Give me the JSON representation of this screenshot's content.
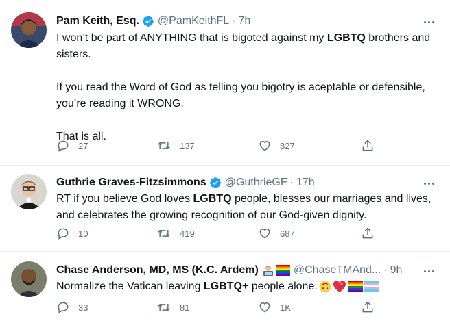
{
  "tweets": [
    {
      "name": "Pam Keith, Esq.",
      "handle": "@PamKeithFL",
      "time": "7h",
      "avatar_icon": "avatar-woman",
      "text_line1_pre": "I won’t be part of ANYTHING that is bigoted against my ",
      "text_line1_bold": "LGBTQ",
      "text_line1_post": " brothers and sisters.",
      "text_para2": "If you read the Word of God as telling you bigotry is aceptable or defensible, you’re reading it WRONG.",
      "text_para3": "That is all.",
      "replies": "27",
      "retweets": "137",
      "likes": "827"
    },
    {
      "name": "Guthrie Graves-Fitzsimmons",
      "handle": "@GuthrieGF",
      "time": "17h",
      "avatar_icon": "avatar-man-glasses",
      "text_pre": "RT if you believe God loves ",
      "text_bold": "LGBTQ",
      "text_post": " people, blesses our marriages and lives, and celebrates the growing recognition of our God-given dignity.",
      "replies": "10",
      "retweets": "419",
      "likes": "687"
    },
    {
      "name": "Chase Anderson, MD, MS (K.C. Ardem)",
      "handle": "@ChaseTMAnd...",
      "time": "9h",
      "avatar_icon": "avatar-man-beard",
      "name_emojis": [
        "man-technologist-emoji",
        "rainbow-flag-emoji"
      ],
      "text_pre": "Normalize the Vatican leaving ",
      "text_bold": "LGBTQ",
      "text_post": "+ people alone.",
      "text_emojis": [
        "upside-down-face-emoji",
        "sparkling-heart-emoji",
        "rainbow-flag-emoji",
        "transgender-flag-emoji"
      ],
      "replies": "33",
      "retweets": "81",
      "likes": "1K"
    }
  ],
  "colors": {
    "verified": "#1da1f2",
    "secondary_text": "#5b7083",
    "divider": "#e6ecf0"
  }
}
